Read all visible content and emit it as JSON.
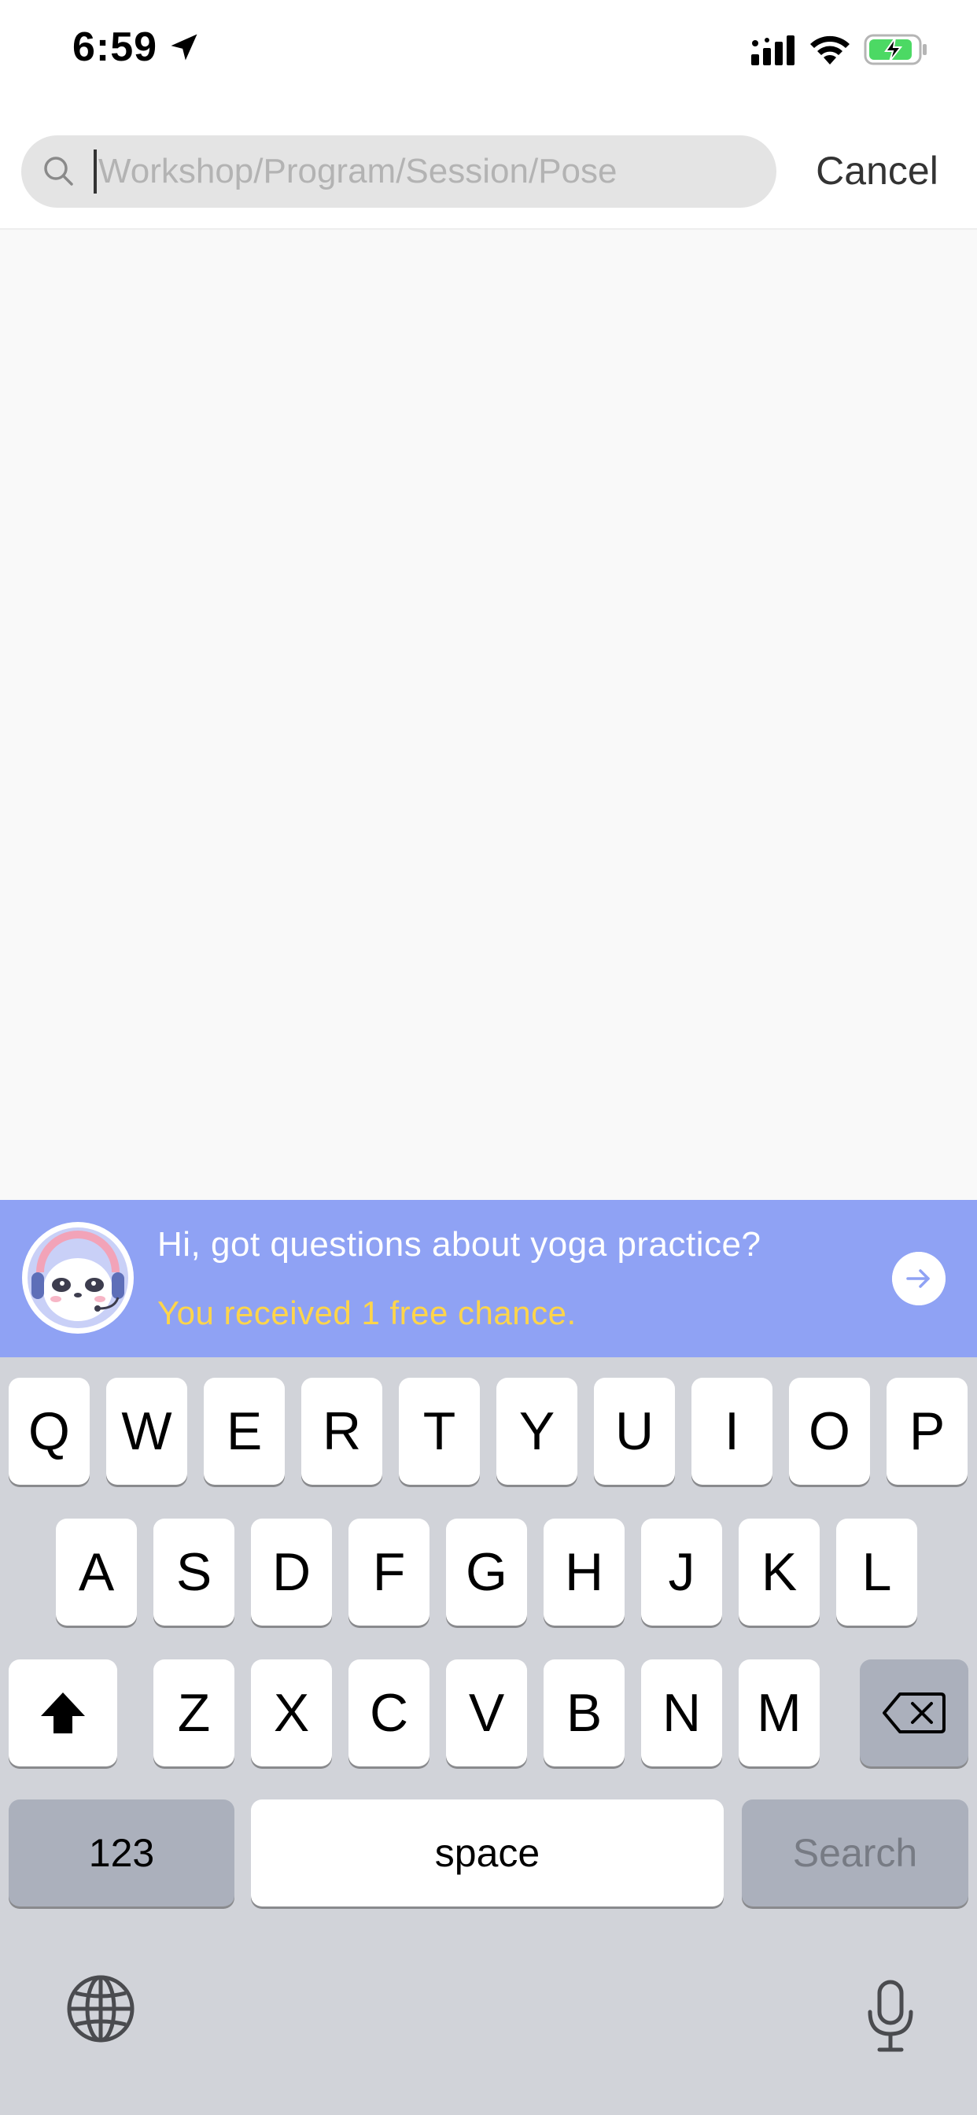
{
  "status_bar": {
    "time": "6:59"
  },
  "search": {
    "placeholder": "Workshop/Program/Session/Pose",
    "value": "",
    "cancel_label": "Cancel"
  },
  "banner": {
    "title": "Hi, got questions about yoga practice?",
    "subtitle": "You received 1 free chance.",
    "background_color": "#8fa2f4",
    "subtitle_color": "#ffd54a"
  },
  "keyboard": {
    "row1": [
      "Q",
      "W",
      "E",
      "R",
      "T",
      "Y",
      "U",
      "I",
      "O",
      "P"
    ],
    "row2": [
      "A",
      "S",
      "D",
      "F",
      "G",
      "H",
      "J",
      "K",
      "L"
    ],
    "row3": [
      "Z",
      "X",
      "C",
      "V",
      "B",
      "N",
      "M"
    ],
    "numbers_label": "123",
    "space_label": "space",
    "search_label": "Search",
    "icons": [
      "shift-icon",
      "backspace-icon",
      "globe-icon",
      "microphone-icon"
    ]
  }
}
